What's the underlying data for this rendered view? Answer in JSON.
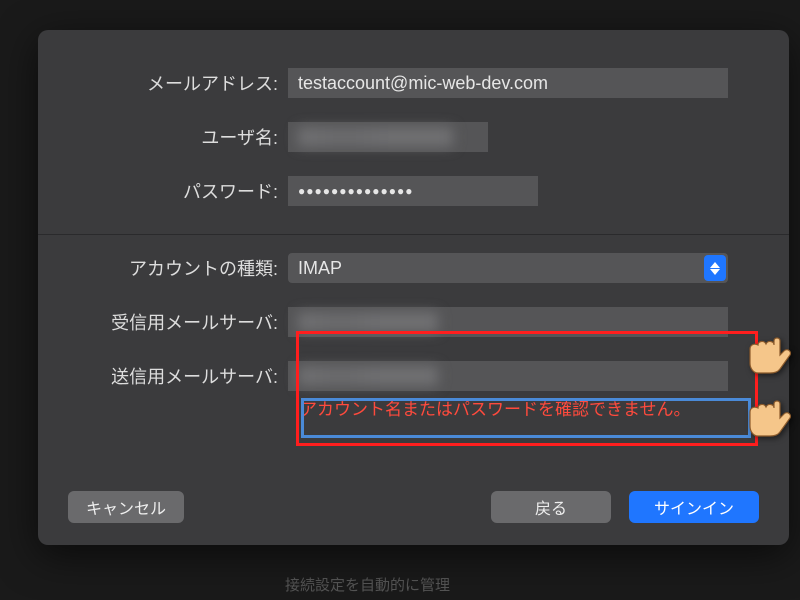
{
  "labels": {
    "email": "メールアドレス:",
    "username": "ユーザ名:",
    "password": "パスワード:",
    "account_type": "アカウントの種類:",
    "incoming": "受信用メールサーバ:",
    "outgoing": "送信用メールサーバ:"
  },
  "fields": {
    "email": "testaccount@mic-web-dev.com",
    "password_mask": "●●●●●●●●●●●●●●",
    "account_type": "IMAP"
  },
  "error": "アカウント名またはパスワードを確認できません。",
  "buttons": {
    "cancel": "キャンセル",
    "back": "戻る",
    "signin": "サインイン"
  },
  "bg": {
    "footer_hint": "接続設定を自動的に管理"
  }
}
